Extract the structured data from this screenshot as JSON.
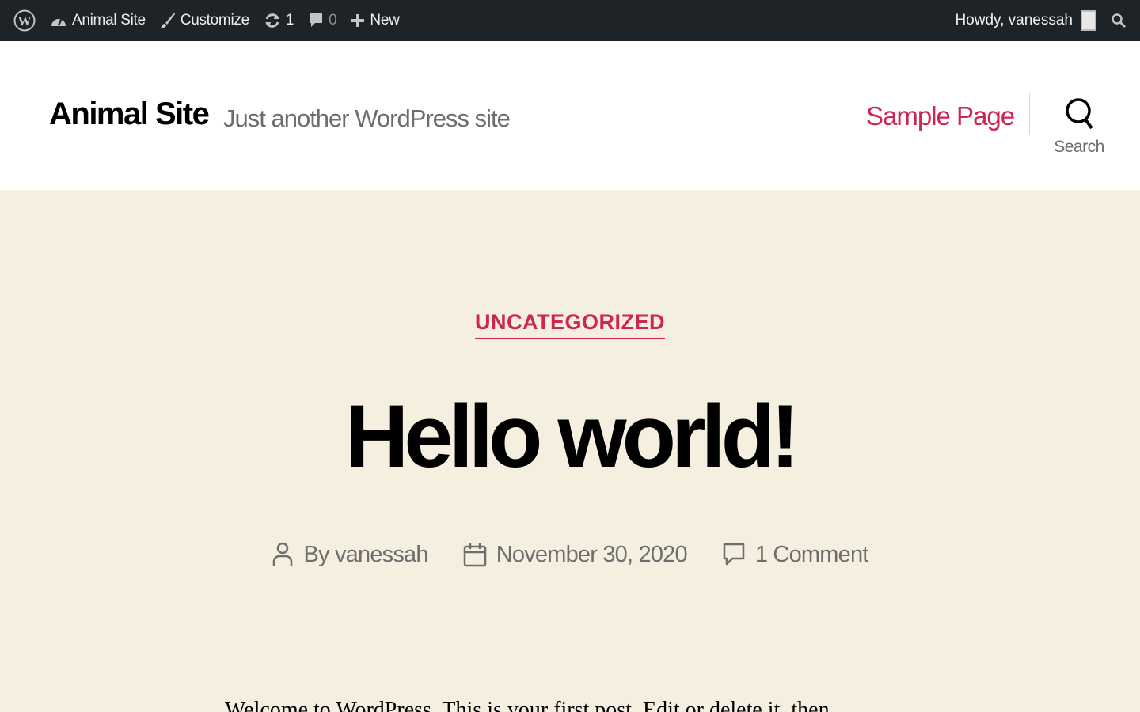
{
  "adminbar": {
    "site_name": "Animal Site",
    "customize": "Customize",
    "updates_count": "1",
    "comments_count": "0",
    "new_label": "New",
    "howdy": "Howdy, vanessah"
  },
  "header": {
    "site_title": "Animal Site",
    "site_description": "Just another WordPress site",
    "nav": {
      "sample_page": "Sample Page"
    },
    "search_label": "Search"
  },
  "post": {
    "category": "UNCATEGORIZED",
    "title": "Hello world!",
    "meta": {
      "author": "By vanessah",
      "date": "November 30, 2020",
      "comments": "1 Comment"
    },
    "excerpt": "Welcome to WordPress. This is your first post. Edit or delete it, then"
  },
  "colors": {
    "accent": "#cd2653",
    "adminbar_bg": "#1d2327",
    "body_bg": "#f5efe0",
    "header_bg": "#ffffff"
  }
}
